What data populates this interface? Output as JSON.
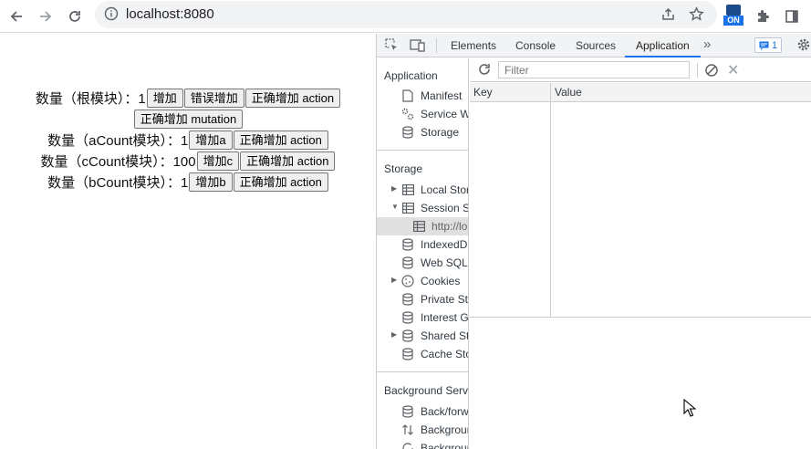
{
  "browser": {
    "url": "localhost:8080"
  },
  "page": {
    "rows": [
      {
        "label": "数量（根模块）：1",
        "buttons": [
          "增加",
          "错误增加",
          "正确增加 action"
        ]
      },
      {
        "label": "",
        "buttons": [
          "正确增加 mutation"
        ]
      },
      {
        "label": "数量（aCount模块）：1",
        "buttons": [
          "增加a",
          "正确增加 action"
        ]
      },
      {
        "label": "数量（cCount模块）：100",
        "buttons": [
          "增加c",
          "正确增加 action"
        ]
      },
      {
        "label": "数量（bCount模块）：1",
        "buttons": [
          "增加b",
          "正确增加 action"
        ]
      }
    ]
  },
  "devtools": {
    "tabs": [
      "Elements",
      "Console",
      "Sources",
      "Application"
    ],
    "active_tab": "Application",
    "issues_count": "1",
    "sidebar": {
      "application_title": "Application",
      "application_items": [
        "Manifest",
        "Service W",
        "Storage"
      ],
      "storage_title": "Storage",
      "storage_items": [
        "Local Stor",
        "Session St",
        "http://lo",
        "IndexedD",
        "Web SQL",
        "Cookies",
        "Private Sta",
        "Interest G",
        "Shared Sto",
        "Cache Sto"
      ],
      "background_title": "Background Servi",
      "background_items": [
        "Back/forw",
        "Backgrour",
        "Backgrour"
      ]
    },
    "filter_placeholder": "Filter",
    "columns": [
      "Key",
      "Value"
    ]
  }
}
